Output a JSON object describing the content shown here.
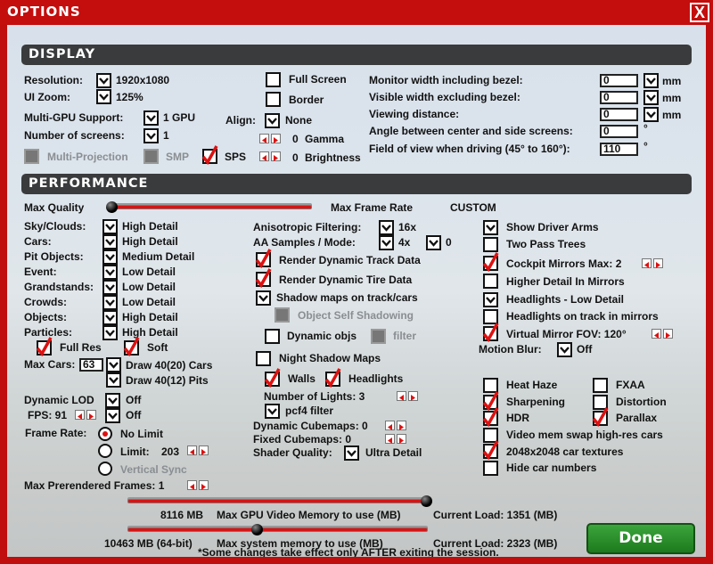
{
  "window": {
    "title": "OPTIONS",
    "close": "X"
  },
  "display": {
    "header": "DISPLAY",
    "resolution_label": "Resolution:",
    "resolution": "1920x1080",
    "ui_zoom_label": "UI Zoom:",
    "ui_zoom": "125%",
    "full_screen": {
      "label": "Full Screen",
      "state": "unchecked"
    },
    "border": {
      "label": "Border",
      "state": "unchecked"
    },
    "multi_gpu_label": "Multi-GPU Support:",
    "multi_gpu": "1 GPU",
    "screens_label": "Number of screens:",
    "screens": "1",
    "align_label": "Align:",
    "align": "None",
    "gamma_value": "0",
    "gamma_label": "Gamma",
    "brightness_value": "0",
    "brightness_label": "Brightness",
    "multi_projection": {
      "label": "Multi-Projection",
      "state": "disabled"
    },
    "smp": {
      "label": "SMP",
      "state": "disabled"
    },
    "sps": {
      "label": "SPS",
      "state": "checked"
    },
    "monitor": [
      {
        "label": "Monitor width including bezel:",
        "value": "0",
        "unit": "mm"
      },
      {
        "label": "Visible width excluding bezel:",
        "value": "0",
        "unit": "mm"
      },
      {
        "label": "Viewing distance:",
        "value": "0",
        "unit": "mm"
      },
      {
        "label": "Angle between center and side screens:",
        "value": "0",
        "unit": "°"
      },
      {
        "label": "Field of view when driving (45° to 160°):",
        "value": "110",
        "unit": "°"
      }
    ]
  },
  "performance": {
    "header": "PERFORMANCE",
    "max_quality_label": "Max Quality",
    "quality_slider_fraction": 0.0,
    "max_frame_rate_label": "Max Frame Rate",
    "preset": "CUSTOM",
    "details": [
      {
        "label": "Sky/Clouds:",
        "value": "High Detail"
      },
      {
        "label": "Cars:",
        "value": "High Detail"
      },
      {
        "label": "Pit Objects:",
        "value": "Medium Detail"
      },
      {
        "label": "Event:",
        "value": "Low Detail"
      },
      {
        "label": "Grandstands:",
        "value": "Low Detail"
      },
      {
        "label": "Crowds:",
        "value": "Low Detail"
      },
      {
        "label": "Objects:",
        "value": "High Detail"
      },
      {
        "label": "Particles:",
        "value": "High Detail"
      }
    ],
    "full_res": {
      "label": "Full Res",
      "state": "checked"
    },
    "soft": {
      "label": "Soft",
      "state": "checked"
    },
    "max_cars_label": "Max Cars:",
    "max_cars": "63",
    "draw_cars": "Draw 40(20) Cars",
    "draw_pits": "Draw 40(12) Pits",
    "dynamic_lod_label": "Dynamic LOD",
    "dynamic_lod": "Off",
    "fps_label": "FPS: 91",
    "fps_value": "Off",
    "frame_rate_label": "Frame Rate:",
    "no_limit": {
      "label": "No Limit",
      "state": "on"
    },
    "limit": {
      "label": "Limit:",
      "value": "203",
      "state": "off"
    },
    "vsync": {
      "label": "Vertical Sync",
      "state": "disabled"
    },
    "prerendered_label": "Max Prerendered Frames: 1",
    "aniso_label": "Anisotropic Filtering:",
    "aniso": "16x",
    "aa_label": "AA Samples / Mode:",
    "aa_samples": "4x",
    "aa_mode": "0",
    "track_data": {
      "label": "Render Dynamic Track Data",
      "state": "checked"
    },
    "tire_data": {
      "label": "Render Dynamic Tire Data",
      "state": "checked"
    },
    "shadow_maps": "Shadow maps on track/cars",
    "self_shadow": {
      "label": "Object Self Shadowing",
      "state": "disabled"
    },
    "dynamic_objs": {
      "label": "Dynamic objs",
      "state": "unchecked"
    },
    "filter": {
      "label": "filter",
      "state": "disabled"
    },
    "night_shadow": {
      "label": "Night Shadow Maps",
      "state": "unchecked"
    },
    "walls": {
      "label": "Walls",
      "state": "checked"
    },
    "headlights": {
      "label": "Headlights",
      "state": "checked"
    },
    "lights_label": "Number of Lights: 3",
    "pcf4": "pcf4 filter",
    "dyn_cubemaps": "Dynamic Cubemaps: 0",
    "fixed_cubemaps": "Fixed Cubemaps: 0",
    "shader_label": "Shader Quality:",
    "shader": "Ultra Detail",
    "driver_arms": "Show Driver Arms",
    "two_pass": {
      "label": "Two Pass Trees",
      "state": "unchecked"
    },
    "cockpit_mirrors": {
      "label": "Cockpit Mirrors  Max:  2",
      "state": "checked"
    },
    "higher_detail": {
      "label": "Higher Detail In Mirrors",
      "state": "unchecked"
    },
    "headlights_low": "Headlights - Low Detail",
    "headlights_mirrors": {
      "label": "Headlights on track in mirrors",
      "state": "unchecked"
    },
    "virtual_mirror": {
      "label": "Virtual Mirror  FOV:  120°",
      "state": "checked"
    },
    "motion_blur_label": "Motion Blur:",
    "motion_blur": "Off",
    "heat_haze": {
      "label": "Heat Haze",
      "state": "unchecked"
    },
    "fxaa": {
      "label": "FXAA",
      "state": "unchecked"
    },
    "sharpening": {
      "label": "Sharpening",
      "state": "checked"
    },
    "distortion": {
      "label": "Distortion",
      "state": "unchecked"
    },
    "hdr": {
      "label": "HDR",
      "state": "checked"
    },
    "parallax": {
      "label": "Parallax",
      "state": "checked"
    },
    "video_swap": {
      "label": "Video mem swap high-res cars",
      "state": "unchecked"
    },
    "textures_2048": {
      "label": "2048x2048 car textures",
      "state": "checked"
    },
    "hide_numbers": {
      "label": "Hide car numbers",
      "state": "unchecked"
    }
  },
  "memory": {
    "gpu_value": "8116 MB",
    "gpu_label": "Max GPU Video Memory to use (MB)",
    "gpu_load": "Current Load: 1351 (MB)",
    "gpu_fraction": 1.0,
    "sys_value": "10463 MB (64-bit)",
    "sys_label": "Max system memory to use (MB)",
    "sys_load": "Current Load: 2323 (MB)",
    "sys_fraction": 0.43
  },
  "note": "*Some changes take effect only AFTER exiting the session.",
  "done": "Done"
}
